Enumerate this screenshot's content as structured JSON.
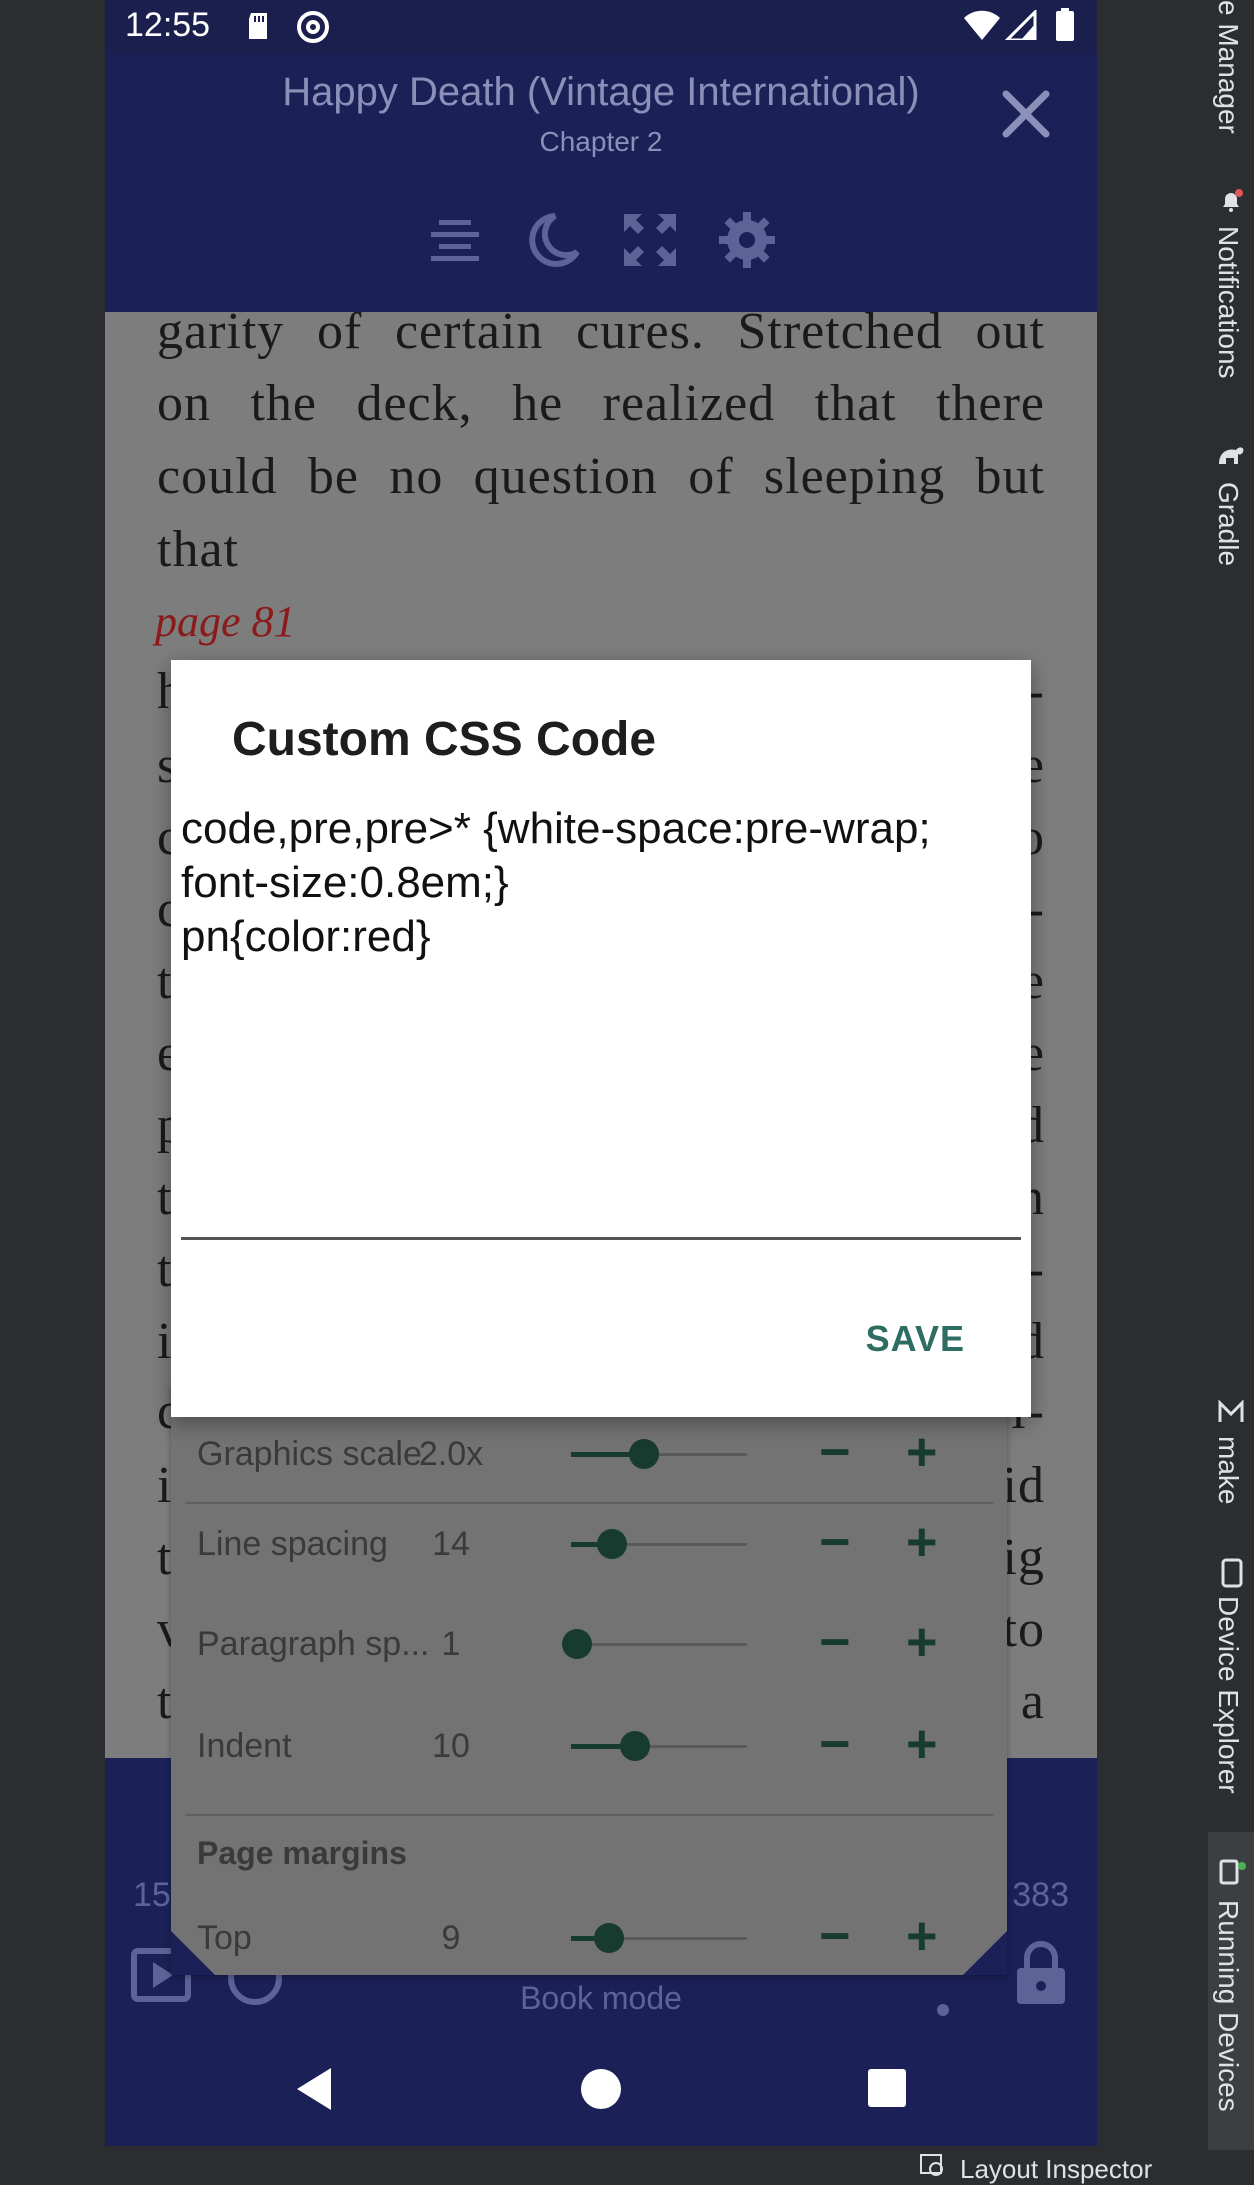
{
  "status_bar": {
    "time": "12:55"
  },
  "app_bar": {
    "title": "Happy Death (Vintage International)",
    "subtitle": "Chapter 2"
  },
  "reader": {
    "lines": [
      "garity of certain cures. Stretched out",
      "on the deck, he realized that there",
      "could be no question of sleeping but",
      "that"
    ],
    "page_marker": "page 81",
    "left_edge_letters": [
      "h",
      "s",
      "c",
      "c",
      "t",
      "e",
      "p",
      "t",
      "t",
      "i",
      "c",
      "i",
      "t",
      "v",
      "t"
    ],
    "right_edge_letters": [
      "-",
      "e",
      "o",
      "-",
      "e",
      "e",
      "d",
      "n",
      "-",
      "d",
      "l-",
      "id",
      "ig",
      "to",
      "a"
    ]
  },
  "dialog": {
    "title": "Custom CSS Code",
    "css_code": "code,pre,pre>* {white-space:pre-wrap;\nfont-size:0.8em;}\npn{color:red}",
    "save_label": "SAVE"
  },
  "settings_panel": {
    "rows": [
      {
        "label": "Graphics scale",
        "value": "2.0x",
        "level": 0.38
      },
      {
        "label": "Line spacing",
        "value": "14",
        "level": 0.2
      },
      {
        "label": "Paragraph sp...",
        "value": "1",
        "level": 0.0
      },
      {
        "label": "Indent",
        "value": "10",
        "level": 0.33
      }
    ],
    "section_label": "Page margins",
    "top_row": {
      "label": "Top",
      "value": "9",
      "level": 0.18
    },
    "minus_glyph": "−",
    "plus_glyph": "+"
  },
  "bottom_bar": {
    "left_page": "15",
    "right_page": "383",
    "mode_label": "Book mode"
  },
  "ide": {
    "right_tabs": [
      "e Manager",
      "Notifications",
      "Gradle",
      "make",
      "Device Explorer",
      "Running Devices"
    ],
    "bottom_label": "Layout Inspector"
  },
  "colors": {
    "app_bar": "#1b2057",
    "accent": "#2e6d62",
    "page_marker": "#8b1a1a"
  }
}
